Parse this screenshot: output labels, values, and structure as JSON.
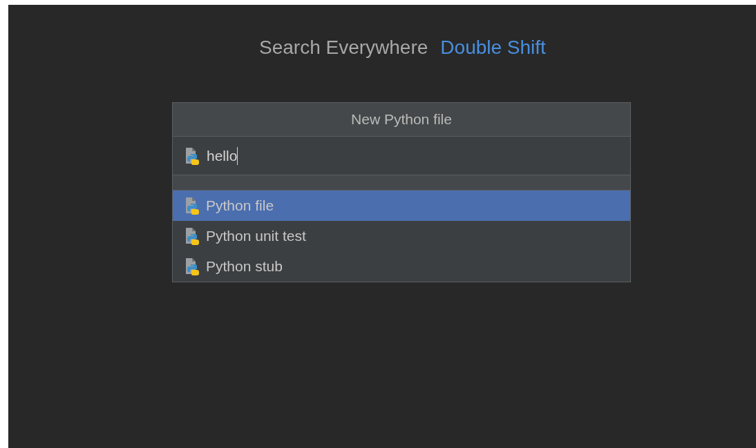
{
  "hints": [
    {
      "action": "Search Everywhere",
      "shortcut": "Double Shift"
    }
  ],
  "dialog": {
    "title": "New Python file",
    "input": {
      "value": "hello"
    },
    "items": [
      {
        "label": "Python file",
        "selected": true
      },
      {
        "label": "Python unit test",
        "selected": false
      },
      {
        "label": "Python stub",
        "selected": false
      }
    ]
  }
}
